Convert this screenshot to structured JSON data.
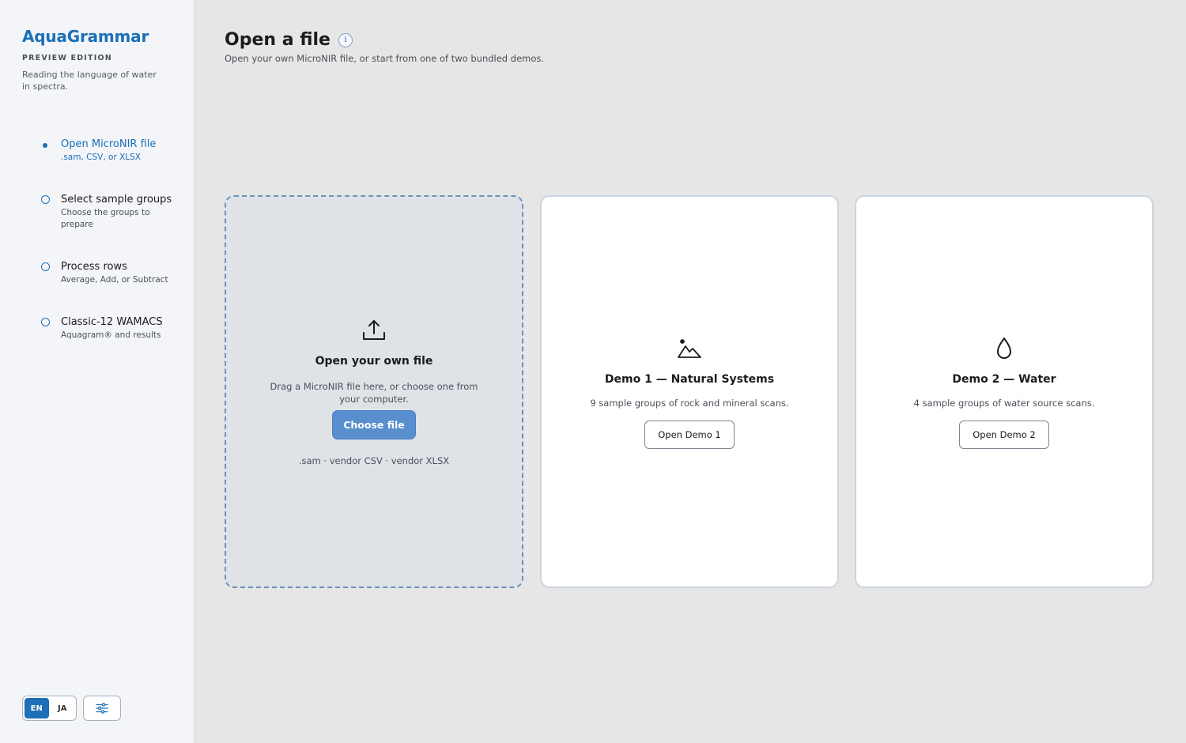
{
  "brand": {
    "title": "AquaGrammar",
    "edition": "PREVIEW EDITION",
    "tagline": "Reading the language of water in spectra."
  },
  "steps": [
    {
      "title": "Open MicroNIR file",
      "subtitle": ".sam, CSV, or XLSX",
      "state": "active"
    },
    {
      "title": "Select sample groups",
      "subtitle": "Choose the groups to prepare",
      "state": "todo"
    },
    {
      "title": "Process rows",
      "subtitle": "Average, Add, or Subtract",
      "state": "todo"
    },
    {
      "title": "Classic-12 WAMACS",
      "subtitle": "Aquagram® and results",
      "state": "todo"
    }
  ],
  "footer": {
    "lang_en": "EN",
    "lang_ja": "JA",
    "settings_icon": "sliders-icon"
  },
  "header": {
    "title": "Open a file",
    "info_glyph": "i",
    "subtitle": "Open your own MicroNIR file, or start from one of two bundled demos."
  },
  "upload": {
    "icon": "upload-icon",
    "title": "Open your own file",
    "description": "Drag a MicroNIR file here, or choose one from your computer.",
    "button": "Choose file",
    "formats": ".sam · vendor CSV · vendor XLSX"
  },
  "demos": [
    {
      "icon": "mountain-icon",
      "title": "Demo 1 — Natural Systems",
      "description": "9 sample groups of rock and mineral scans.",
      "button": "Open Demo 1"
    },
    {
      "icon": "water-drop-icon",
      "title": "Demo 2 — Water",
      "description": "4 sample groups of water source scans.",
      "button": "Open Demo 2"
    }
  ],
  "colors": {
    "accent": "#1d6fb8",
    "button_primary": "#5a8fcf",
    "background": "#e6e6e6",
    "sidebar": "#f3f5f9"
  }
}
